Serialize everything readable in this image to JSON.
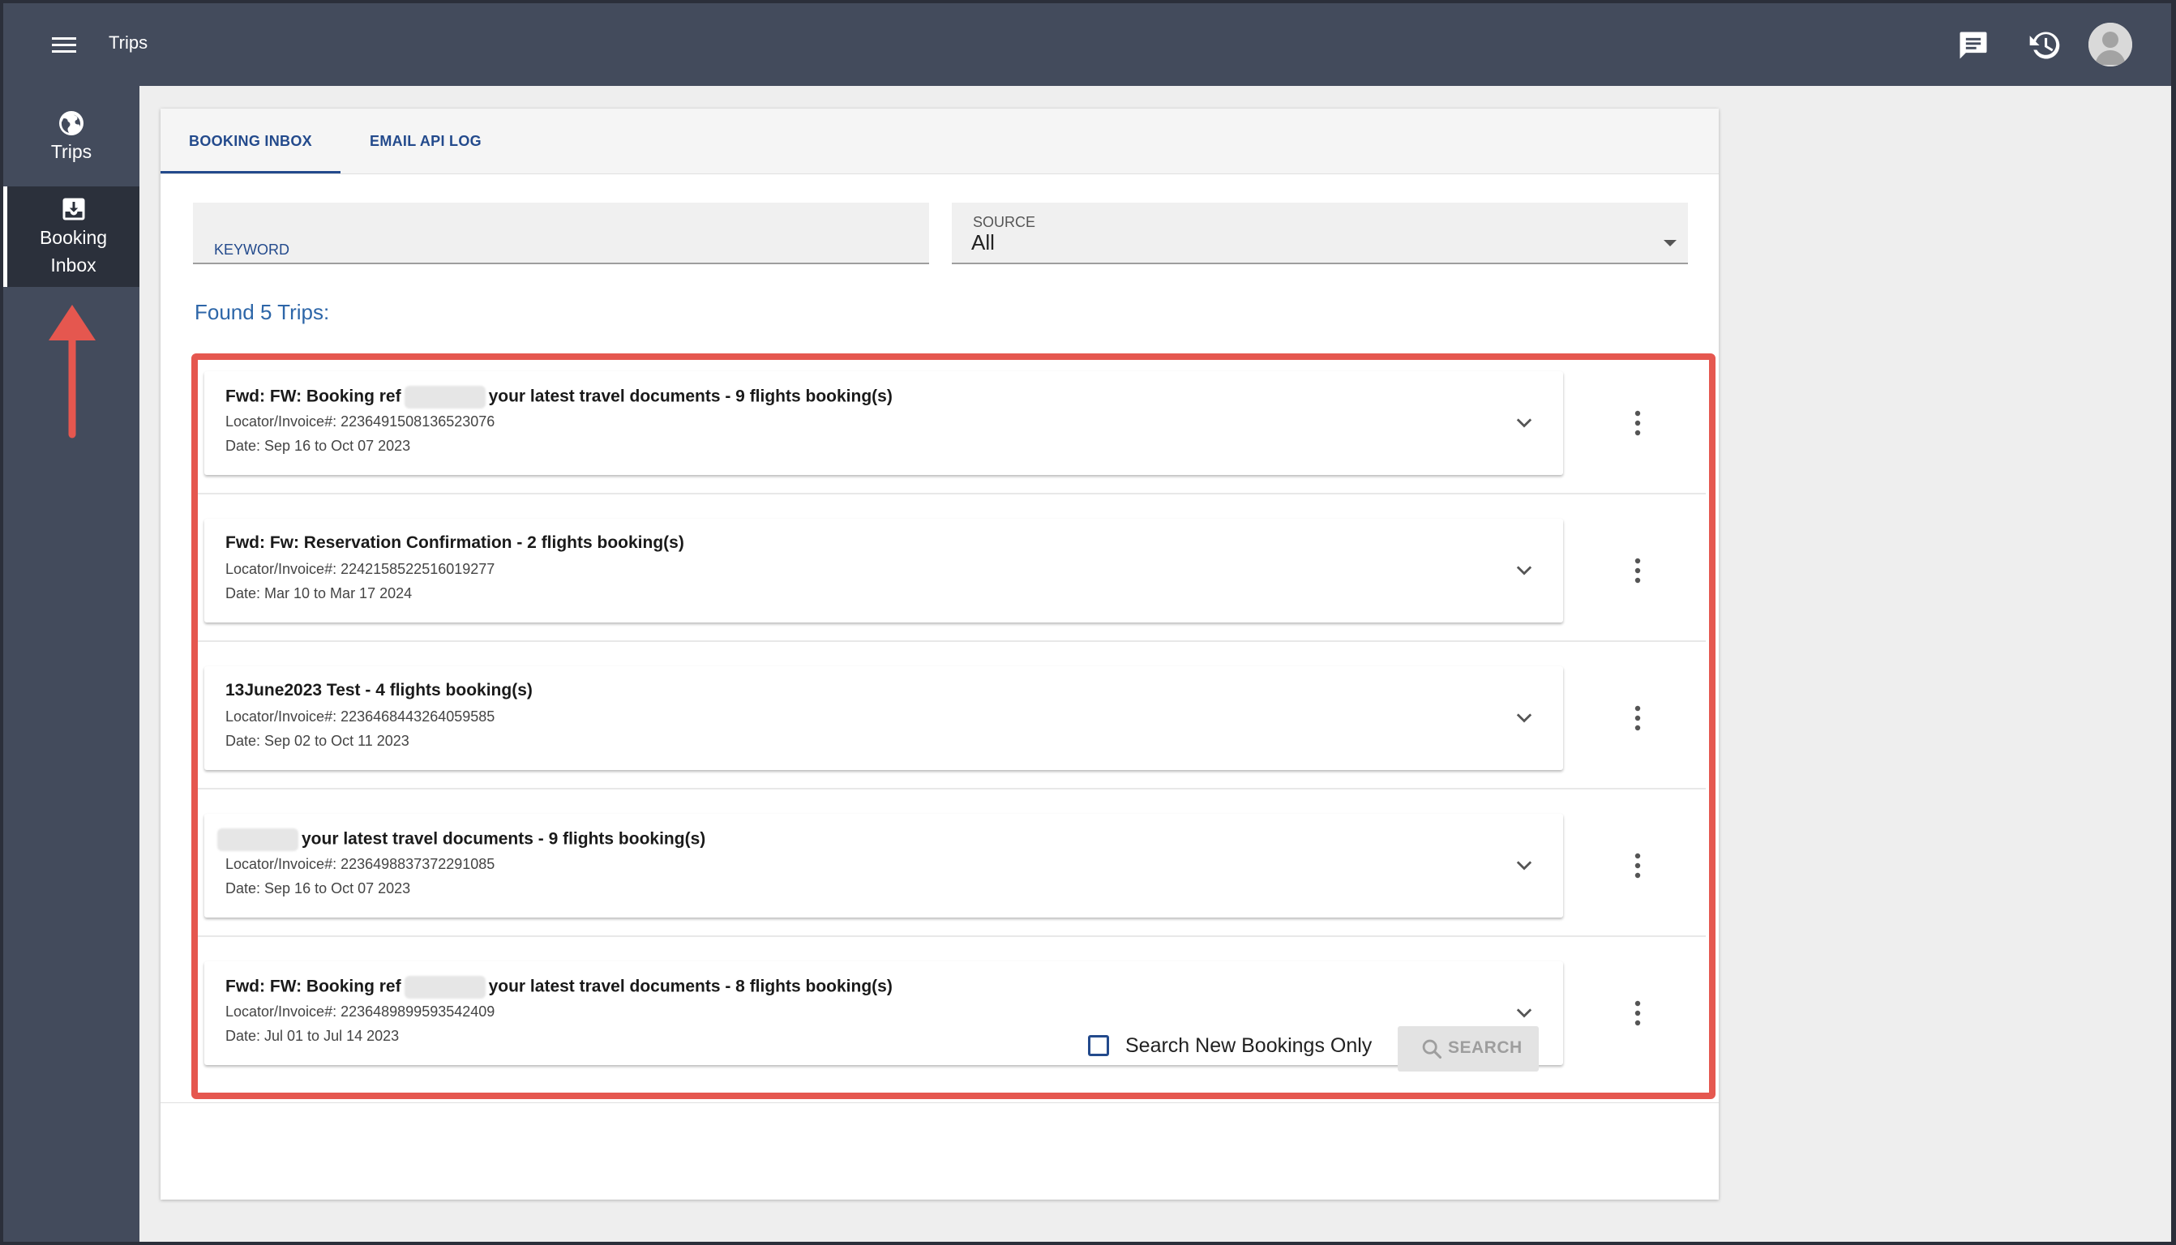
{
  "header": {
    "app_title": "Trips"
  },
  "nav": {
    "items": [
      {
        "label": "Trips",
        "icon": "globe-icon"
      },
      {
        "label_line1": "Booking",
        "label_line2": "Inbox",
        "icon": "inbox-icon",
        "active": true
      }
    ]
  },
  "tabs": [
    {
      "label": "BOOKING INBOX",
      "active": true
    },
    {
      "label": "EMAIL API LOG",
      "active": false
    }
  ],
  "filters": {
    "keyword": {
      "label": "KEYWORD",
      "value": ""
    },
    "source": {
      "label": "SOURCE",
      "value": "All"
    }
  },
  "results": {
    "found_text": "Found 5 Trips:",
    "trips": [
      {
        "title_prefix": "Fwd: FW: Booking ref",
        "title_suffix": "your latest travel documents - 9 flights booking(s)",
        "locator": "Locator/Invoice#: 2236491508136523076",
        "date": "Date: Sep 16 to Oct 07 2023"
      },
      {
        "title": "Fwd: Fw: Reservation Confirmation - 2 flights booking(s)",
        "locator": "Locator/Invoice#: 2242158522516019277",
        "date": "Date: Mar 10 to Mar 17 2024"
      },
      {
        "title": "13June2023 Test - 4 flights booking(s)",
        "locator": "Locator/Invoice#: 2236468443264059585",
        "date": "Date: Sep 02 to Oct 11 2023"
      },
      {
        "title_suffix": "your latest travel documents - 9 flights booking(s)",
        "locator": "Locator/Invoice#: 2236498837372291085",
        "date": "Date: Sep 16 to Oct 07 2023"
      },
      {
        "title_prefix": "Fwd: FW: Booking ref",
        "title_suffix": "your latest travel documents - 8 flights booking(s)",
        "locator": "Locator/Invoice#: 2236489899593542409",
        "date": "Date: Jul 01 to Jul 14 2023"
      }
    ]
  },
  "footer": {
    "checkbox_label": "Search New Bookings Only",
    "checkbox_checked": false,
    "search_label": "SEARCH"
  },
  "colors": {
    "topbar": "#434b5c",
    "accent": "#234a8c",
    "annotation": "#e5574f"
  }
}
